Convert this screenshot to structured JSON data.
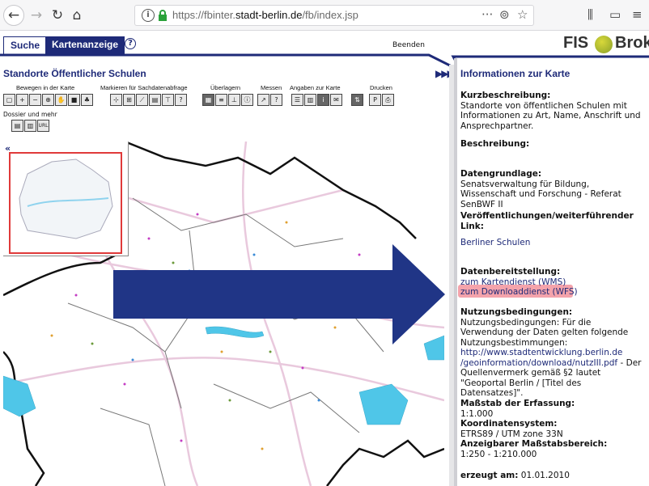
{
  "browser": {
    "url_prefix": "https://fbinter.",
    "url_domain": "stadt-berlin.de",
    "url_path": "/fb/index.jsp",
    "icons": [
      "back-icon",
      "forward-icon",
      "reload-icon",
      "home-icon",
      "info-icon",
      "lock-icon",
      "more-icon",
      "pocket-icon",
      "bookmark-star-icon",
      "library-icon",
      "sidebar-icon",
      "menu-icon"
    ]
  },
  "header": {
    "tab_suche": "Suche",
    "tab_karte": "Kartenanzeige",
    "beenden": "Beenden",
    "brand_left": "FIS",
    "brand_right": "Broker"
  },
  "left": {
    "title": "Standorte Öffentlicher Schulen",
    "toolbar_groups": [
      "Bewegen in der Karte",
      "Markieren für Sachdatenabfrage",
      "Überlagern",
      "Messen",
      "Angaben zur Karte",
      "Drucken"
    ],
    "dossier": "Dossier und mehr",
    "overview_toggle": "«",
    "collapse": "▶▶▶"
  },
  "right": {
    "title": "Informationen zur Karte",
    "kurz_h": "Kurzbeschreibung:",
    "kurz_t": "Standorte von öffentlichen Schulen mit Informationen zu Art, Name, Anschrift und Ansprechpartner.",
    "beschr_h": "Beschreibung:",
    "daten_h": "Datengrundlage:",
    "daten_t": "Senatsverwaltung für Bildung, Wissenschaft und Forschung - Referat SenBWF II",
    "veroeff_h": "Veröffentlichungen/weiterführender Link:",
    "veroeff_link": "Berliner Schulen",
    "bereit_h": "Datenbereitstellung:",
    "wms": "zum Kartendienst (WMS)",
    "wfs": "zum Downloaddienst (WFS)",
    "nutz_h": "Nutzungsbedingungen:",
    "nutz_t": "Nutzungsbedingungen: Für die Verwendung der Daten gelten folgende Nutzungsbestimmungen:",
    "nutz_link": "http://www.stadtentwicklung.berlin.de/geoinformation/download/nutzIII.pdf",
    "nutz_link_a": "http://www.stadtentwicklung.berlin.de",
    "nutz_link_b": "/geoinformation/download/nutzIII.pdf",
    "nutz_t2": " - Der Quellenvermerk gemäß §2 lautet \"Geoportal Berlin / [Titel des Datensatzes]\".",
    "mass_h": "Maßstab der Erfassung:",
    "mass_t": "1:1.000",
    "koord_h": "Koordinatensystem:",
    "koord_t": "ETRS89 / UTM zone 33N",
    "anz_h": "Anzeigbarer Maßstabsbereich:",
    "anz_t": "1:250 - 1:210.000",
    "erzeugt_h": "erzeugt am:",
    "erzeugt_t": "01.01.2010"
  }
}
